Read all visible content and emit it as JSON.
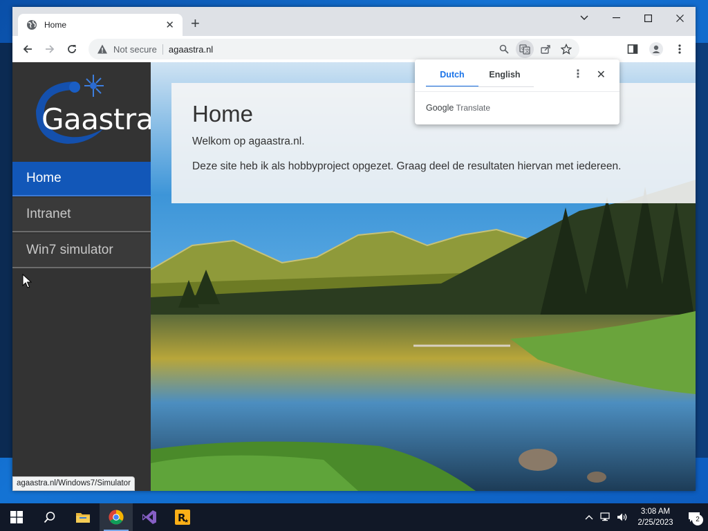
{
  "browser": {
    "tab_title": "Home",
    "new_tab_symbol": "+",
    "address": {
      "security_label": "Not secure",
      "url": "agaastra.nl"
    }
  },
  "site": {
    "logo_text": "Gaastra",
    "nav": [
      {
        "label": "Home",
        "active": true
      },
      {
        "label": "Intranet",
        "active": false
      },
      {
        "label": "Win7 simulator",
        "active": false
      }
    ],
    "heading": "Home",
    "paragraphs": [
      "Welkom op agaastra.nl.",
      "Deze site heb ik als hobbyproject opgezet. Graag deel de resultaten hiervan met iedereen."
    ]
  },
  "translate_popup": {
    "tabs": [
      "Dutch",
      "English"
    ],
    "selected": "Dutch",
    "brand_google": "Google",
    "brand_translate": "Translate"
  },
  "status_url": "agaastra.nl/Windows7/Simulator",
  "taskbar": {
    "apps": [
      "start-icon",
      "search-icon",
      "file-explorer-icon",
      "chrome-icon",
      "visual-studio-icon",
      "rockstar-launcher-icon"
    ],
    "time": "3:08 AM",
    "date": "2/25/2023",
    "notification_count": "2"
  },
  "colors": {
    "nav_active": "#1257b8",
    "sidebar": "#333333",
    "accent": "#1a73e8"
  }
}
